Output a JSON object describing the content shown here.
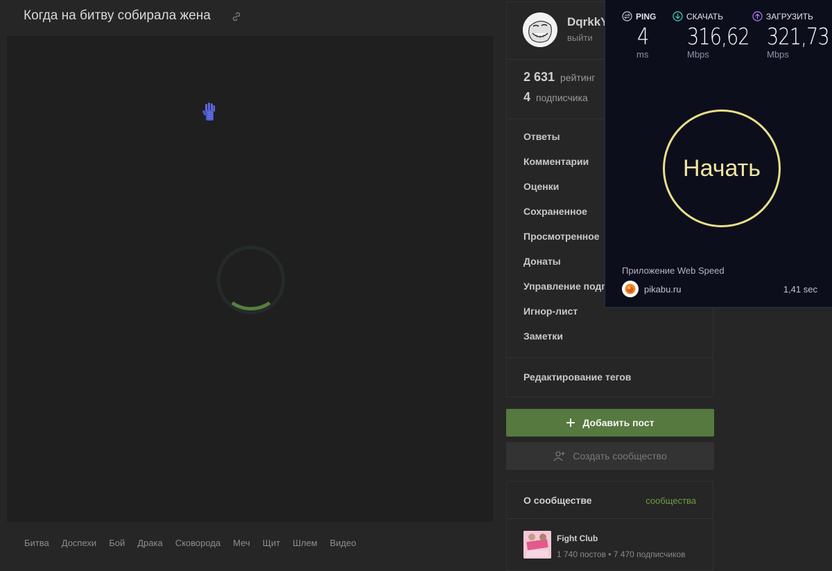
{
  "post": {
    "title": "Когда на битву собирала жена",
    "tags": [
      "Битва",
      "Доспехи",
      "Бой",
      "Драка",
      "Сковорода",
      "Меч",
      "Щит",
      "Шлем",
      "Видео"
    ]
  },
  "profile": {
    "username": "DqrkkY",
    "logout_label": "выйти",
    "rating_value": "2 631",
    "rating_label": "рейтинг",
    "subscribers_value": "4",
    "subscribers_label": "подписчика",
    "menu": [
      "Ответы",
      "Комментарии",
      "Оценки",
      "Сохраненное",
      "Просмотренное",
      "Донаты",
      "Управление подписками",
      "Игнор-лист",
      "Заметки"
    ],
    "edit_tags_label": "Редактирование тегов"
  },
  "actions": {
    "add_post_label": "Добавить пост",
    "create_community_label": "Создать сообщество"
  },
  "about": {
    "title": "О сообществе",
    "link_label": "сообщества",
    "community_name": "Fight Club",
    "community_meta": "1 740 постов  •  7 470 подписчиков"
  },
  "speedtest": {
    "ping": {
      "label": "PING",
      "value": "4",
      "unit": "ms"
    },
    "download": {
      "label": "СКАЧАТЬ",
      "value": "316,62",
      "unit": "Mbps"
    },
    "upload": {
      "label": "ЗАГРУЗИТЬ",
      "value": "321,73",
      "unit": "Mbps"
    },
    "start_label": "Начать",
    "app_label": "Приложение Web Speed",
    "site": "pikabu.ru",
    "time": "1,41 sec"
  },
  "colors": {
    "accent_green": "#56793f",
    "link_green": "#6b9d3f",
    "start_ring": "#e8df89",
    "panel_bg": "#0d0e1c"
  }
}
